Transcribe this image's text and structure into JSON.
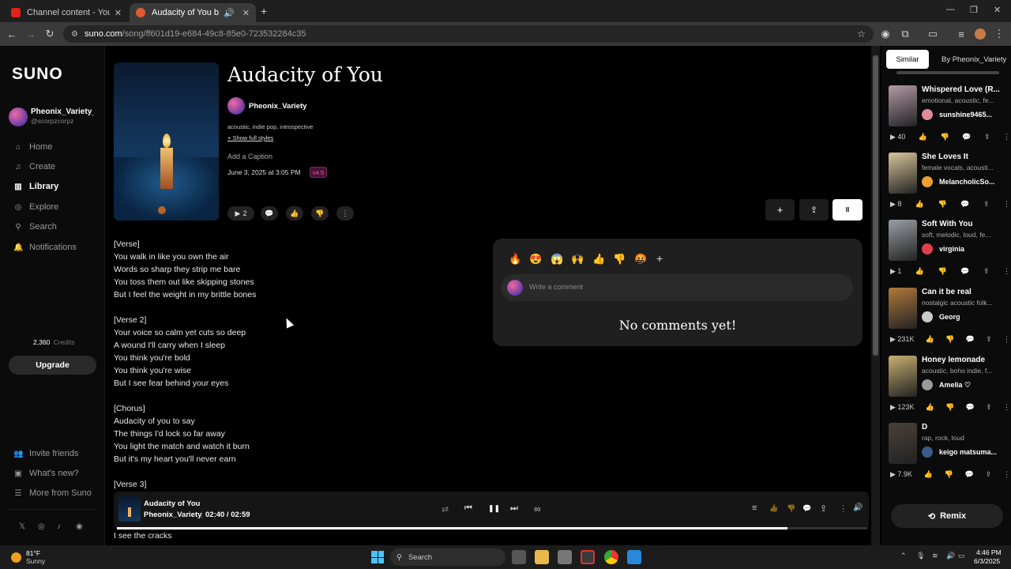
{
  "browser": {
    "tabs": [
      {
        "label": "Channel content - YouTube Stu",
        "close": "✕"
      },
      {
        "label": "Audacity of You by Pheonix",
        "close": "✕"
      }
    ],
    "new_tab": "+",
    "window_controls": {
      "minimize": "—",
      "maximize": "❐",
      "close": "✕"
    },
    "url_host": "suno.com",
    "url_path": "/song/ff601d19-e684-49c8-85e0-723532284c35"
  },
  "sidebar": {
    "logo": "SUNO",
    "user_name": "Pheonix_Variety",
    "user_handle": "@scorpzcorpz",
    "nav": [
      {
        "label": "Home",
        "icon": "⌂"
      },
      {
        "label": "Create",
        "icon": "♫"
      },
      {
        "label": "Library",
        "icon": "▥"
      },
      {
        "label": "Explore",
        "icon": "◎"
      },
      {
        "label": "Search",
        "icon": "⚲"
      },
      {
        "label": "Notifications",
        "icon": "🔔"
      }
    ],
    "credits_value": "2,360",
    "credits_label": "Credits",
    "upgrade": "Upgrade",
    "footer": [
      {
        "label": "Invite friends",
        "icon": "👥"
      },
      {
        "label": "What's new?",
        "icon": "▣"
      },
      {
        "label": "More from Suno",
        "icon": "☰"
      }
    ],
    "social": [
      "𝕏",
      "◎",
      "♪",
      "◉"
    ]
  },
  "song": {
    "title": "Audacity of You",
    "artist": "Pheonix_Variety",
    "styles": "acoustic, indie pop, introspective",
    "show_styles": "+ Show full styles",
    "caption": "Add a Caption",
    "date": "June 3, 2025 at 3:05 PM",
    "version": "v4.5",
    "play_count": "2",
    "action_icons": {
      "play": "▶",
      "comment": "💬",
      "like": "👍",
      "dislike": "👎",
      "more": "⋮"
    },
    "right_actions": {
      "add": "+",
      "share": "⇪",
      "pause": "II"
    }
  },
  "lyrics": [
    "[Verse]",
    "You walk in like you own the air",
    "Words so sharp they strip me bare",
    "You toss them out like skipping stones",
    "But I feel the weight in my brittle bones",
    "",
    "[Verse 2]",
    "Your voice so calm yet cuts so deep",
    "A wound I'll carry when I sleep",
    "You think you're bold",
    "You think you're wise",
    "But I see fear behind your eyes",
    "",
    "[Chorus]",
    "Audacity of you to say",
    "The things I'd lock so far away",
    "You light the match and watch it burn",
    "But it's my heart you'll never earn",
    "",
    "[Verse 3]",
    "",
    "I see the cracks"
  ],
  "comments": {
    "reactions": [
      "🔥",
      "😍",
      "😱",
      "🙌",
      "👍",
      "👎",
      "🤬",
      "+"
    ],
    "placeholder": "Write a comment",
    "empty": "No comments yet!"
  },
  "right_panel": {
    "tabs": [
      "Similar",
      "By Pheonix_Variety"
    ],
    "remix": "Remix",
    "remix_icon": "⟲",
    "songs": [
      {
        "title": "Whispered Love (R...",
        "styles": "emotional, acoustic, fe...",
        "user": "sunshine9465...",
        "plays": "40",
        "thumb": "#b49aa8",
        "avatar": "#e08a9a"
      },
      {
        "title": "She Loves It",
        "styles": "female vocals, acousti...",
        "user": "MelancholicSo...",
        "plays": "8",
        "thumb": "#d8c79a",
        "avatar": "#f0a030"
      },
      {
        "title": "Soft With You",
        "styles": "soft, melodic, loud, fe...",
        "user": "virginia",
        "plays": "1",
        "thumb": "#9aa0a6",
        "avatar": "#e04050"
      },
      {
        "title": "Can it be real",
        "styles": "nostalgic acoustic folk...",
        "user": "Georg",
        "plays": "231K",
        "thumb": "#b07a3a",
        "avatar": "#c9c9c9"
      },
      {
        "title": "Honey lemonade",
        "styles": "acoustic, boho indie, f...",
        "user": "Amelia ♡",
        "plays": "123K",
        "thumb": "#c9b070",
        "avatar": "#999999"
      },
      {
        "title": "D",
        "styles": "rap, rock, loud",
        "user": "keigo matsuma...",
        "plays": "7.9K",
        "thumb": "#4a4038",
        "avatar": "#3a5a8a"
      }
    ]
  },
  "player": {
    "title": "Audacity of You",
    "artist": "Pheonix_Variety",
    "time": "02:40 / 02:59",
    "progress": 0.894,
    "icons": {
      "repeat": "⇄",
      "prev": "⏮",
      "pause": "❚❚",
      "next": "⏭",
      "link": "∞",
      "queue": "≡",
      "like": "👍",
      "dislike": "👎",
      "comment": "💬",
      "share": "⇪",
      "more": "⋮",
      "volume": "🔊"
    }
  },
  "taskbar": {
    "temp": "81°F",
    "weather": "Sunny",
    "search": "Search",
    "time": "4:46 PM",
    "date": "6/3/2025"
  }
}
